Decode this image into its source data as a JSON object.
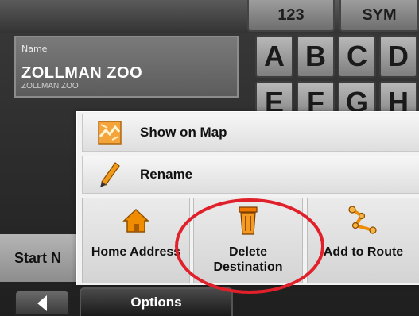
{
  "keyboard": {
    "mode_buttons": [
      "123",
      "SYM"
    ],
    "row1": [
      "A",
      "B",
      "C",
      "D"
    ],
    "row2": [
      "E",
      "F",
      "G",
      "H"
    ]
  },
  "name_field": {
    "label": "Name",
    "value": "ZOLLMAN ZOO",
    "subtitle": "ZOLLMAN ZOO"
  },
  "start_button": {
    "label": "Start N"
  },
  "options_menu": {
    "show_on_map": "Show on Map",
    "rename": "Rename",
    "home_address": "Home Address",
    "delete_line1": "Delete",
    "delete_line2": "Destination",
    "add_to_route": "Add to Route"
  },
  "tabs": {
    "options": "Options"
  },
  "colors": {
    "highlight": "#e0202a",
    "home_icon": "#f08c00",
    "trash_icon": "#f07800"
  }
}
